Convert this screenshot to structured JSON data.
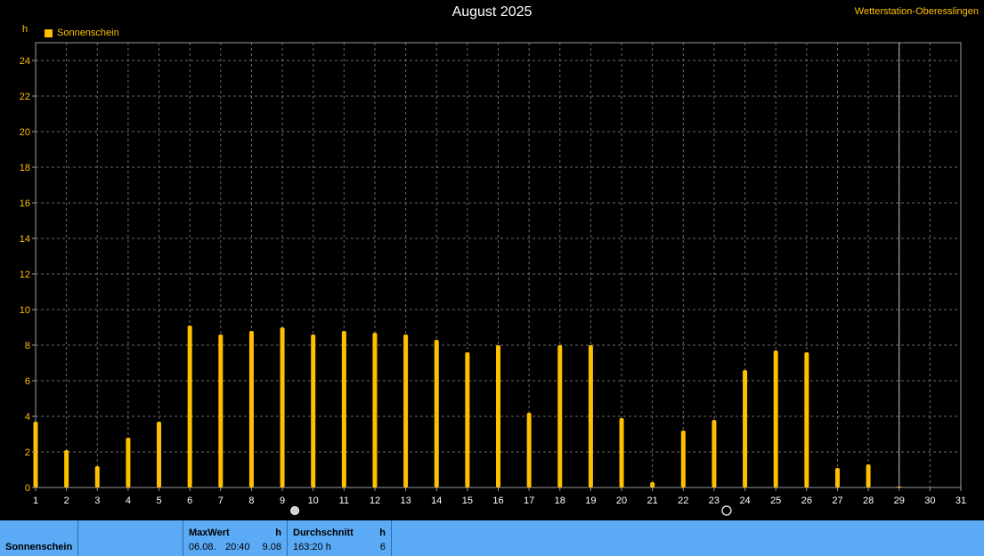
{
  "header": {
    "title": "August 2025",
    "station": "Wetterstation-Oberesslingen",
    "unit": "h"
  },
  "legend": {
    "label": "Sonnenschein",
    "color": "#ffc000"
  },
  "chart_data": {
    "type": "bar",
    "title": "August 2025",
    "ylabel": "h",
    "ylim": [
      0,
      25
    ],
    "yticks": [
      0,
      2,
      4,
      6,
      8,
      10,
      12,
      14,
      16,
      18,
      20,
      22,
      24
    ],
    "grid": true,
    "legend_position": "top-left",
    "categories": [
      "1",
      "2",
      "3",
      "4",
      "5",
      "6",
      "7",
      "8",
      "9",
      "10",
      "11",
      "12",
      "13",
      "14",
      "15",
      "16",
      "17",
      "18",
      "19",
      "20",
      "21",
      "22",
      "23",
      "24",
      "25",
      "26",
      "27",
      "28",
      "29",
      "30",
      "31"
    ],
    "series": [
      {
        "name": "Sonnenschein",
        "color": "#ffc000",
        "values": [
          3.7,
          2.1,
          1.2,
          2.8,
          3.7,
          9.1,
          8.6,
          8.8,
          9.0,
          8.6,
          8.8,
          8.7,
          8.6,
          8.3,
          7.6,
          8.0,
          4.2,
          8.0,
          8.0,
          3.9,
          0.3,
          3.2,
          3.8,
          6.6,
          7.7,
          7.6,
          1.1,
          1.3,
          0.05,
          null,
          null
        ]
      }
    ],
    "current_day": 29,
    "moon_markers": [
      {
        "day": 9,
        "icon": "full-moon-icon"
      },
      {
        "day": 23,
        "icon": "new-moon-icon"
      }
    ]
  },
  "stats": {
    "row_label": "Sonnenschein",
    "max": {
      "header": "MaxWert",
      "unit": "h",
      "date": "06.08.",
      "time": "20:40",
      "value": "9.08"
    },
    "avg": {
      "header": "Durchschnitt",
      "unit": "h",
      "total": "163:20 h",
      "value": "6"
    }
  }
}
